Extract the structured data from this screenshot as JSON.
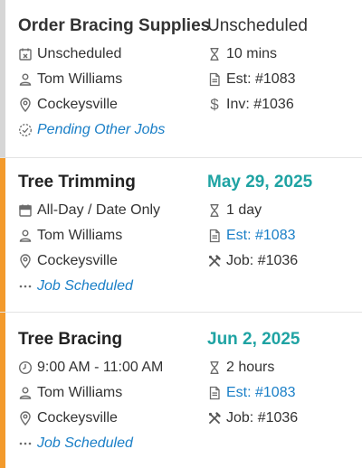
{
  "colors": {
    "gray_stripe": "#d6d6d6",
    "orange_stripe": "#f39a2c",
    "teal_date": "#1fa3a3",
    "link_blue": "#1a7fc7"
  },
  "jobs": [
    {
      "title": "Order Bracing Supplies",
      "status": "Unscheduled",
      "schedule": "Unscheduled",
      "schedule_icon": "calendar-x-icon",
      "assignee": "Tom Williams",
      "location": "Cockeysville",
      "job_status": "Pending Other Jobs",
      "job_status_icon": "dashed-check-circle-icon",
      "duration": "10 mins",
      "estimate": "Est: #1083",
      "invoice": "Inv: #1036",
      "stripe_color": "gray"
    },
    {
      "title": "Tree Trimming",
      "date": "May 29, 2025",
      "schedule": "All-Day / Date Only",
      "schedule_icon": "calendar-icon",
      "assignee": "Tom Williams",
      "location": "Cockeysville",
      "job_status": "Job Scheduled",
      "job_status_icon": "ellipsis-icon",
      "duration": "1 day",
      "estimate": "Est: #1083",
      "job_ref": "Job: #1036",
      "stripe_color": "orange"
    },
    {
      "title": "Tree Bracing",
      "date": "Jun 2, 2025",
      "schedule": "9:00 AM - 11:00 AM",
      "schedule_icon": "clock-icon",
      "assignee": "Tom Williams",
      "location": "Cockeysville",
      "job_status": "Job Scheduled",
      "job_status_icon": "ellipsis-icon",
      "duration": "2 hours",
      "estimate": "Est: #1083",
      "job_ref": "Job: #1036",
      "stripe_color": "orange"
    }
  ]
}
